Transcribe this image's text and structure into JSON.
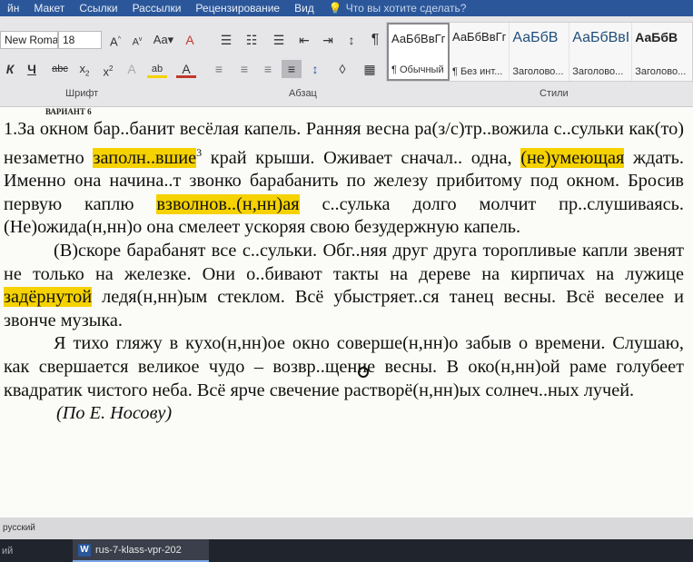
{
  "ribbon_tabs": [
    "йн",
    "Макет",
    "Ссылки",
    "Рассылки",
    "Рецензирование",
    "Вид"
  ],
  "tell_me": "Что вы хотите сделать?",
  "font": {
    "name": "New Roman",
    "size": "18"
  },
  "groups": {
    "font": "Шрифт",
    "paragraph": "Абзац",
    "styles": "Стили"
  },
  "styles": [
    {
      "preview": "АаБбВвГг,",
      "name": "¶ Обычный",
      "selected": true
    },
    {
      "preview": "АаБбВвГг",
      "name": "¶ Без инт...",
      "selected": false
    },
    {
      "preview": "АаБбВ",
      "name": "Заголово...",
      "selected": false
    },
    {
      "preview": "АаБбВвІ",
      "name": "Заголово...",
      "selected": false
    },
    {
      "preview": "АаБбВ",
      "name": "Заголово...",
      "selected": false
    }
  ],
  "document": {
    "variant": "ВАРИАНТ 6",
    "p1": {
      "a": "1.За окном бар..банит весёлая капель. Ранняя весна ра(з/с)тр..вожила с..сульки как(то) незаметно ",
      "h1": "заполн..вшие",
      "sup": "3",
      "b": " край крыши. Оживает сначал.. одна, ",
      "h2": "(не)умеющая",
      "c": " ждать. Именно она начина..т звонко барабанить по железу прибитому под окном. Бросив первую каплю ",
      "h3": "взволнов..(н,нн)ая",
      "d": " с..сулька долго молчит пр..слушиваясь. (Не)ожида(н,нн)о она смелеет ускоряя свою безудержную капель."
    },
    "p2": {
      "a": "(В)скоре барабанят все с..сульки. Обг..няя друг друга торопливые капли звенят не только на железке. Они о..бивают такты на дереве на кирпичах на лужице ",
      "h1": "задёрнутой",
      "b": " ледя(н,нн)ым стеклом. Всё убыстряет..ся танец весны. Всё веселее и звонче музыка."
    },
    "p3": "Я тихо гляжу в кухо(н,нн)ое окно соверше(н,нн)о забыв о времени. Слушаю, как свершается великое чудо – возвр..щение весны. В око(н,нн)ой раме голубеет квадратик чистого неба. Всё ярче свечение растворё(н,нн)ых солнеч..ных лучей.",
    "source": "(По Е. Носову)"
  },
  "status": {
    "language": "русский"
  },
  "taskbar": {
    "left": "ий",
    "word_task": "rus-7-klass-vpr-202"
  }
}
